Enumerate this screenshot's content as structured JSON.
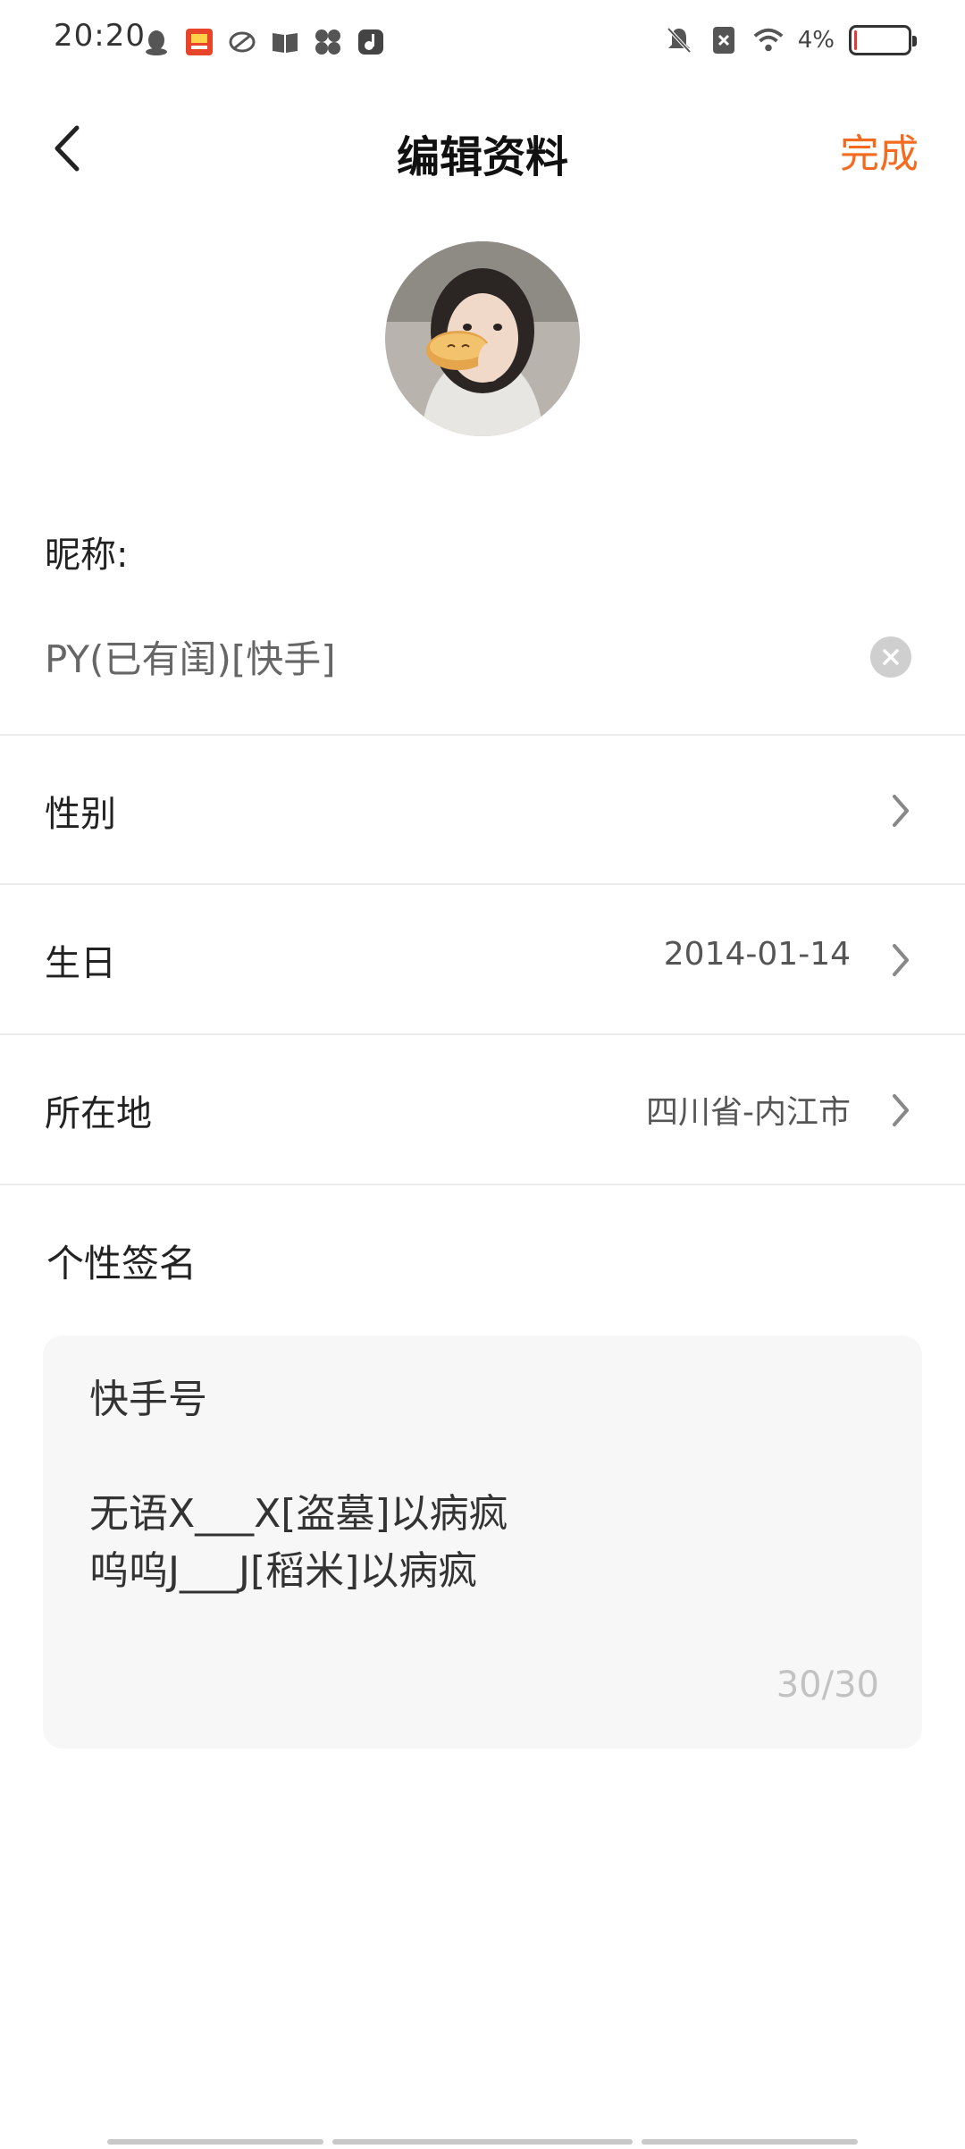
{
  "status_bar": {
    "time": "20:20",
    "battery_percent": "4%",
    "battery_level": 0.04,
    "left_icons": [
      "qq-icon",
      "app-badge-icon",
      "browser-icon",
      "book-icon",
      "pinwheel-icon",
      "music-icon"
    ],
    "right_icons": [
      "mute-icon",
      "sim-off-icon",
      "wifi-icon"
    ]
  },
  "header": {
    "title": "编辑资料",
    "done_label": "完成"
  },
  "profile": {
    "nickname_label": "昵称:",
    "nickname_value": "PY(已有闺)[快手]"
  },
  "rows": {
    "gender": {
      "label": "性别",
      "value": ""
    },
    "birthday": {
      "label": "生日",
      "value": "2014-01-14"
    },
    "location": {
      "label": "所在地",
      "value": "四川省-内江市"
    }
  },
  "signature": {
    "label": "个性签名",
    "text": "快手号\n\n无语X___X[盗墓]以病疯\n呜呜J___J[稻米]以病疯",
    "count": "30/30"
  },
  "colors": {
    "accent": "#f46a1f",
    "divider": "#ececec",
    "box_bg": "#f7f7f7"
  }
}
